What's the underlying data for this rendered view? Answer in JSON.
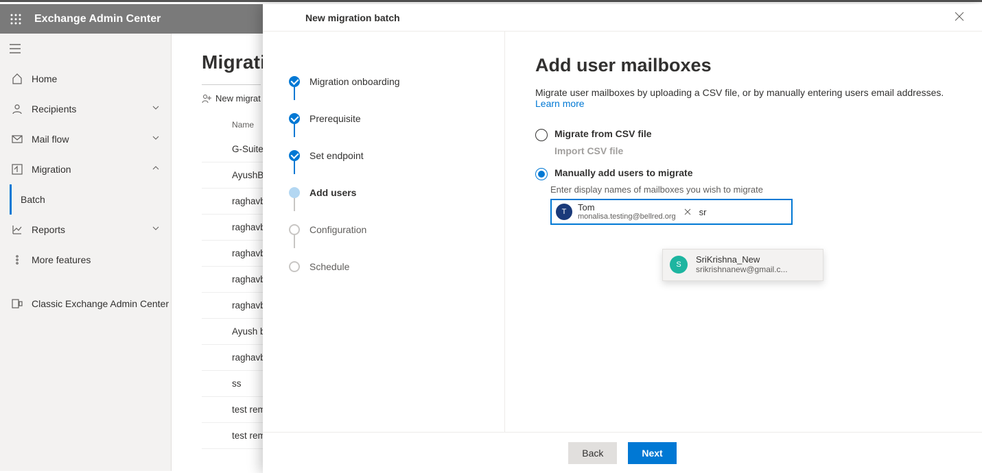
{
  "topbar": {
    "brand": "Exchange Admin Center"
  },
  "nav": {
    "home": "Home",
    "recipients": "Recipients",
    "mailflow": "Mail flow",
    "migration": "Migration",
    "batch": "Batch",
    "reports": "Reports",
    "more": "More features",
    "classic": "Classic Exchange Admin Center"
  },
  "bg": {
    "title": "Migrati",
    "newbatch": "New migrat",
    "colhead": "Name",
    "rows": [
      "G-Suite",
      "AyushB",
      "raghavb",
      "raghavb",
      "raghavb",
      "raghavb",
      "raghavb",
      "Ayush b",
      "raghavb",
      "ss",
      "test rem",
      "test rem"
    ]
  },
  "panel": {
    "title": "New migration batch"
  },
  "steps": {
    "s1": "Migration onboarding",
    "s2": "Prerequisite",
    "s3": "Set endpoint",
    "s4": "Add users",
    "s5": "Configuration",
    "s6": "Schedule"
  },
  "main": {
    "heading": "Add user mailboxes",
    "desc": "Migrate user mailboxes by uploading a CSV file, or by manually entering users email addresses. ",
    "learn": "Learn more",
    "opt_csv": "Migrate from CSV file",
    "import_csv": "Import CSV file",
    "opt_manual": "Manually add users to migrate",
    "hint": "Enter display names of mailboxes you wish to migrate",
    "chip": {
      "initial": "T",
      "name": "Tom",
      "mail": "monalisa.testing@bellred.org"
    },
    "input_value": "sr",
    "suggest": {
      "initial": "S",
      "name": "SriKrishna_New",
      "mail": "srikrishnanew@gmail.c..."
    }
  },
  "footer": {
    "back": "Back",
    "next": "Next"
  }
}
